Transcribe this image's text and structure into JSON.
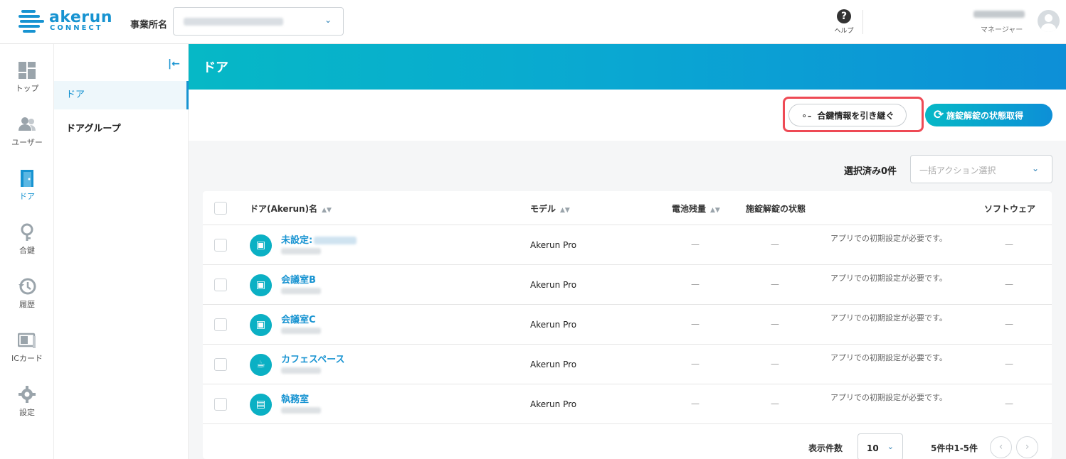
{
  "header": {
    "logo_text": "akerun",
    "logo_sub": "CONNECT",
    "office_label": "事業所名",
    "help_label": "ヘルプ",
    "user_role": "マネージャー"
  },
  "nav": {
    "items": [
      {
        "label": "トップ",
        "icon": "dashboard-icon"
      },
      {
        "label": "ユーザー",
        "icon": "users-icon"
      },
      {
        "label": "ドア",
        "icon": "door-icon"
      },
      {
        "label": "合鍵",
        "icon": "key-icon"
      },
      {
        "label": "履歴",
        "icon": "history-icon"
      },
      {
        "label": "ICカード",
        "icon": "ic-card-icon"
      },
      {
        "label": "設定",
        "icon": "gear-icon"
      }
    ]
  },
  "subnav": {
    "items": [
      {
        "label": "ドア"
      },
      {
        "label": "ドアグループ"
      }
    ]
  },
  "page": {
    "title": "ドア",
    "transfer_button": "合鍵情報を引き継ぐ",
    "status_button": "施錠解錠の状態取得",
    "selected_count": "選択済み0件",
    "bulk_placeholder": "一括アクション選択"
  },
  "table": {
    "headers": {
      "name": "ドア(Akerun)名",
      "model": "モデル",
      "battery": "電池残量",
      "lock_status": "施錠解錠の状態",
      "software": "ソフトウェア"
    },
    "rows": [
      {
        "name": "未設定:",
        "model": "Akerun Pro",
        "battery": "—",
        "lock": "—",
        "note": "アプリでの初期設定が必要です。",
        "software": "—",
        "icon": "door-icon"
      },
      {
        "name": "会議室B",
        "model": "Akerun Pro",
        "battery": "—",
        "lock": "—",
        "note": "アプリでの初期設定が必要です。",
        "software": "—",
        "icon": "meeting-room-icon"
      },
      {
        "name": "会議室C",
        "model": "Akerun Pro",
        "battery": "—",
        "lock": "—",
        "note": "アプリでの初期設定が必要です。",
        "software": "—",
        "icon": "meeting-room-icon"
      },
      {
        "name": "カフェスペース",
        "model": "Akerun Pro",
        "battery": "—",
        "lock": "—",
        "note": "アプリでの初期設定が必要です。",
        "software": "—",
        "icon": "cafe-icon"
      },
      {
        "name": "執務室",
        "model": "Akerun Pro",
        "battery": "—",
        "lock": "—",
        "note": "アプリでの初期設定が必要です。",
        "software": "—",
        "icon": "office-desk-icon"
      }
    ]
  },
  "pagination": {
    "per_page_label": "表示件数",
    "per_page_value": "10",
    "range_text": "5件中1-5件"
  },
  "colors": {
    "accent": "#1793d1",
    "teal": "#06b8c6",
    "highlight": "#ee4a55"
  }
}
